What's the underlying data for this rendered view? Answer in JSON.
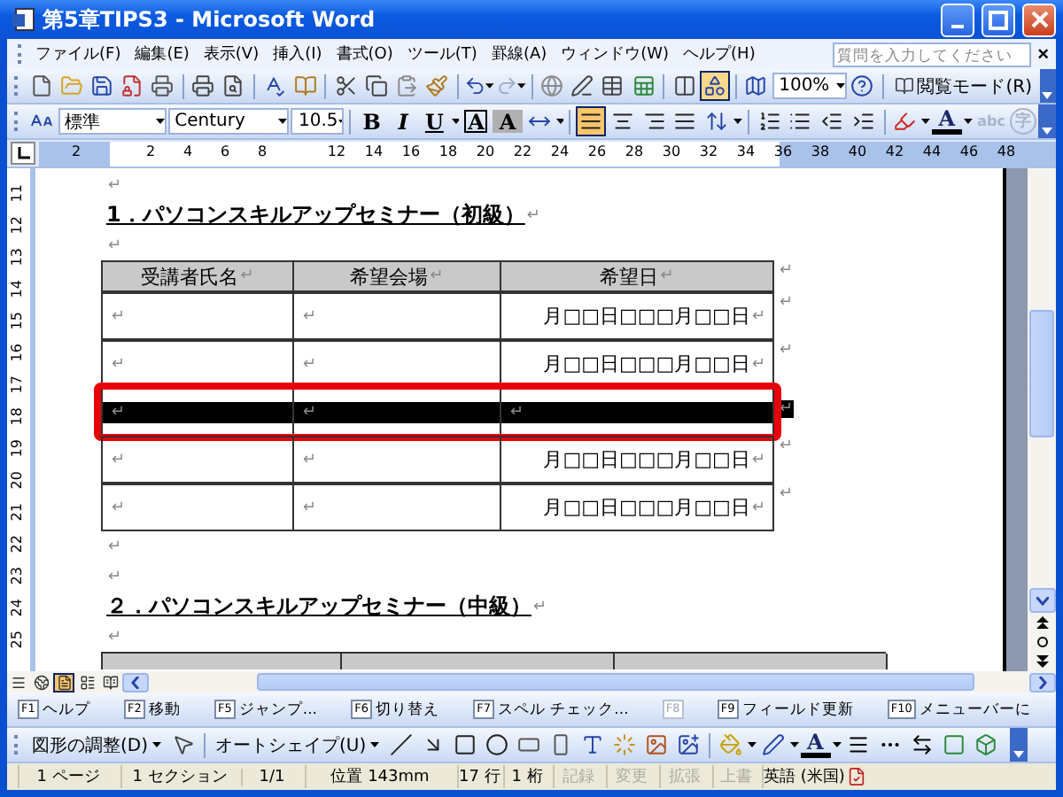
{
  "window": {
    "title": "第5章TIPS3 - Microsoft Word"
  },
  "menu_bar": {
    "items": [
      "ファイル(F)",
      "編集(E)",
      "表示(V)",
      "挿入(I)",
      "書式(O)",
      "ツール(T)",
      "罫線(A)",
      "ウィンドウ(W)",
      "ヘルプ(H)"
    ],
    "help_search": {
      "placeholder": "質問を入力してください"
    },
    "close": "×"
  },
  "standard_toolbar": {
    "drawing_pressed": true,
    "zoom": "100%",
    "reading_mode": "閲覧モード(R)"
  },
  "formatting_toolbar": {
    "style": "標準",
    "font": "Century",
    "size": "10.5",
    "bold": "B",
    "italic": "I",
    "underline": "U",
    "char_border": "A",
    "char_shading": "A",
    "alignment": [
      {
        "selected": true
      },
      {
        "selected": false
      },
      {
        "selected": false
      },
      {
        "selected": false
      }
    ],
    "font_color": "A",
    "phonetic_guide": "abc",
    "enclose": "字"
  },
  "ruler": {
    "labels": [
      "2",
      "2",
      "4",
      "6",
      "8",
      "12",
      "14",
      "16",
      "18",
      "20",
      "22",
      "24",
      "26",
      "28",
      "30",
      "32",
      "34",
      "36",
      "38",
      "40",
      "42",
      "44",
      "46",
      "48"
    ]
  },
  "vertical_ruler": {
    "labels": [
      "11",
      "12",
      "13",
      "14",
      "15",
      "16",
      "17",
      "18",
      "19",
      "20",
      "21",
      "22",
      "23",
      "24",
      "25"
    ]
  },
  "document": {
    "blocks": [
      {
        "kind": "paragraph",
        "mark": "↵"
      },
      {
        "kind": "heading",
        "text": "1．パソコンスキルアップセミナー（初級）",
        "mark": "↵"
      },
      {
        "kind": "paragraph",
        "mark": "↵"
      },
      {
        "kind": "table",
        "columns": [
          {
            "text": "受講者氏名",
            "mark": "↵"
          },
          {
            "text": "希望会場",
            "mark": "↵"
          },
          {
            "text": "希望日",
            "mark": "↵"
          }
        ],
        "header_end_mark": "↵",
        "rows": [
          {
            "selected": false,
            "framed": false,
            "end_mark": "↵",
            "cells": [
              {
                "mark": "↵"
              },
              {
                "mark": "↵"
              },
              {
                "text": "月□□日□□□月□□日",
                "mark": "↵"
              }
            ]
          },
          {
            "selected": false,
            "framed": false,
            "end_mark": "↵",
            "cells": [
              {
                "mark": "↵"
              },
              {
                "mark": "↵"
              },
              {
                "text": "月□□日□□□月□□日",
                "mark": "↵"
              }
            ]
          },
          {
            "selected": true,
            "framed": true,
            "end_mark": "↵",
            "cells": [
              {
                "mark": "↵"
              },
              {
                "mark": "↵"
              },
              {
                "mark": "↵"
              }
            ]
          },
          {
            "selected": false,
            "framed": false,
            "end_mark": "↵",
            "cells": [
              {
                "mark": "↵"
              },
              {
                "mark": "↵"
              },
              {
                "text": "月□□日□□□月□□日",
                "mark": "↵"
              }
            ]
          },
          {
            "selected": false,
            "framed": false,
            "end_mark": "↵",
            "cells": [
              {
                "mark": "↵"
              },
              {
                "mark": "↵"
              },
              {
                "text": "月□□日□□□月□□日",
                "mark": "↵"
              }
            ]
          }
        ]
      },
      {
        "kind": "paragraph",
        "mark": "↵"
      },
      {
        "kind": "paragraph",
        "mark": "↵"
      },
      {
        "kind": "heading",
        "text": "２．パソコンスキルアップセミナー（中級）",
        "mark": "↵"
      },
      {
        "kind": "paragraph",
        "mark": "↵"
      },
      {
        "kind": "table_stub"
      }
    ]
  },
  "views": [
    {
      "selected": false
    },
    {
      "selected": false
    },
    {
      "selected": true
    },
    {
      "selected": false
    },
    {
      "selected": false
    }
  ],
  "function_keys": [
    {
      "key": "F1",
      "label": "ヘルプ",
      "disabled": false
    },
    {
      "key": "F2",
      "label": "移動",
      "disabled": false
    },
    {
      "key": "F5",
      "label": "ジャンプ...",
      "disabled": false
    },
    {
      "key": "F6",
      "label": "切り替え",
      "disabled": false
    },
    {
      "key": "F7",
      "label": "スペル チェック...",
      "disabled": false
    },
    {
      "key": "F8",
      "disabled": true
    },
    {
      "key": "F9",
      "label": "フィールド更新",
      "disabled": false
    },
    {
      "key": "F10",
      "label": "メニューバーに",
      "disabled": false
    }
  ],
  "drawing_toolbar": {
    "arrange": "図形の調整(D)",
    "autoshapes": "オートシェイプ(U)",
    "font_color": "A"
  },
  "status_bar": {
    "cells": [
      {
        "text": "1 ページ",
        "disabled": false
      },
      {
        "text": "1 セクション",
        "disabled": false
      },
      {
        "text": "1/1",
        "disabled": false
      },
      {
        "text": "位置 143mm",
        "disabled": false
      },
      {
        "text": "17 行",
        "disabled": false
      },
      {
        "text": "1 桁",
        "disabled": false
      },
      {
        "text": "記録",
        "disabled": true
      },
      {
        "text": "変更",
        "disabled": true
      },
      {
        "text": "拡張",
        "disabled": true
      },
      {
        "text": "上書",
        "disabled": true
      },
      {
        "text": "英語 (米国)",
        "disabled": false
      }
    ]
  }
}
